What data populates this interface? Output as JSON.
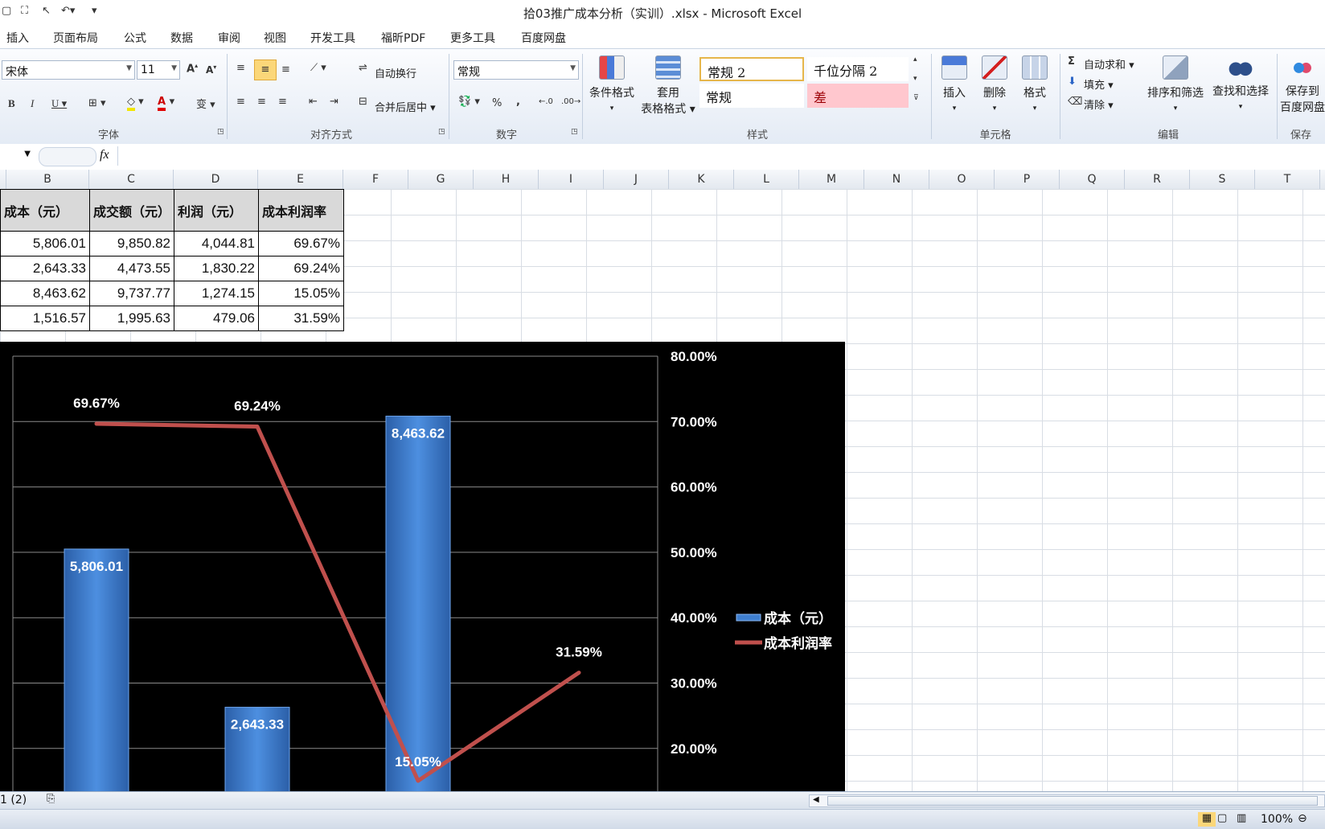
{
  "window": {
    "title": "拾03推广成本分析（实训）.xlsx - Microsoft Excel"
  },
  "menu": [
    "插入",
    "页面布局",
    "公式",
    "数据",
    "审阅",
    "视图",
    "开发工具",
    "福昕PDF",
    "更多工具",
    "百度网盘"
  ],
  "ribbon": {
    "font_name": "宋体",
    "font_size": "11",
    "wrap_text": "自动换行",
    "merge_center": "合并后居中",
    "number_format": "常规",
    "percent_symbol": "%",
    "comma_symbol": ",",
    "cond_format": "条件格式",
    "table_format_1": "套用",
    "table_format_2": "表格格式",
    "styles": [
      "常规 2",
      "千位分隔 2",
      "常规",
      "差"
    ],
    "insert": "插入",
    "delete": "删除",
    "format": "格式",
    "autosum": "自动求和",
    "fill": "填充",
    "clear": "清除",
    "sort_filter": "排序和筛选",
    "find_select": "查找和选择",
    "save_to_1": "保存到",
    "save_to_2": "百度网盘",
    "groups": {
      "font": "字体",
      "align": "对齐方式",
      "number": "数字",
      "styles": "样式",
      "cells": "单元格",
      "edit": "编辑",
      "save": "保存"
    }
  },
  "formula": {
    "fx": "fx"
  },
  "columns": [
    "B",
    "C",
    "D",
    "E",
    "F",
    "G",
    "H",
    "I",
    "J",
    "K",
    "L",
    "M",
    "N",
    "O",
    "P",
    "Q",
    "R",
    "S",
    "T"
  ],
  "table": {
    "headers": [
      "成本（元）",
      "成交额（元）",
      "利润（元）",
      "成本利润率"
    ],
    "rows": [
      [
        "5,806.01",
        "9,850.82",
        "4,044.81",
        "69.67%"
      ],
      [
        "2,643.33",
        "4,473.55",
        "1,830.22",
        "69.24%"
      ],
      [
        "8,463.62",
        "9,737.77",
        "1,274.15",
        "15.05%"
      ],
      [
        "1,516.57",
        "1,995.63",
        "479.06",
        "31.59%"
      ]
    ]
  },
  "chart_data": {
    "type": "bar",
    "series": [
      {
        "name": "成本（元）",
        "type": "bar",
        "values": [
          5806.01,
          2643.33,
          8463.62
        ],
        "labels": [
          "5,806.01",
          "2,643.33",
          "8,463.62"
        ],
        "color": "#3f7fd0"
      },
      {
        "name": "成本利润率",
        "type": "line",
        "values": [
          69.67,
          69.24,
          15.05,
          31.59
        ],
        "labels": [
          "69.67%",
          "69.24%",
          "15.05%",
          "31.59%"
        ],
        "color": "#c0504d"
      }
    ],
    "y2_ticks": [
      "80.00%",
      "70.00%",
      "60.00%",
      "50.00%",
      "40.00%",
      "30.00%",
      "20.00%"
    ],
    "y2_range": [
      10,
      80
    ],
    "legend_position": "right",
    "background": "#000000"
  },
  "sheet_tab": "1 (2)",
  "status": {
    "zoom": "100%"
  }
}
